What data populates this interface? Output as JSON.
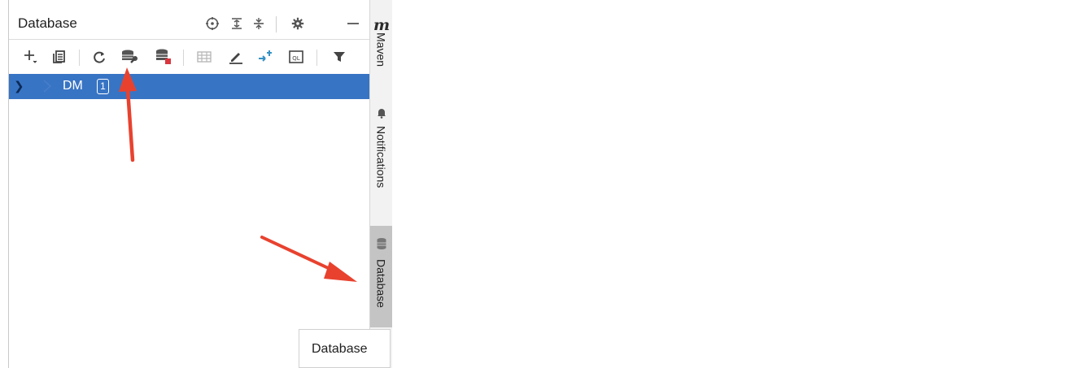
{
  "panel": {
    "title": "Database",
    "header_icons": [
      "crosshair-icon",
      "expand-all-icon",
      "collapse-all-icon",
      "gear-icon",
      "minimize-icon"
    ],
    "toolbar_icons": [
      "add-icon",
      "duplicate-icon",
      "refresh-icon",
      "data-source-properties-icon",
      "disconnect-icon",
      "table-icon",
      "edit-icon",
      "jump-to-query-console-icon",
      "sql-console-icon",
      "filter-icon"
    ]
  },
  "tree": {
    "items": [
      {
        "label": "DM",
        "badge": "1",
        "selected": true
      }
    ]
  },
  "side_stripe": {
    "tabs": [
      {
        "label": "Maven",
        "icon": "maven-icon"
      },
      {
        "label": "Notifications",
        "icon": "bell-icon"
      },
      {
        "label": "Database",
        "icon": "database-icon",
        "active": true
      }
    ],
    "top_icon_letter": "m"
  },
  "tooltip": {
    "text": "Database"
  },
  "colors": {
    "selection": "#3874c4",
    "annotation_arrow": "#e8422f",
    "stop_red": "#d9363e",
    "accent_blue": "#3592c4"
  }
}
